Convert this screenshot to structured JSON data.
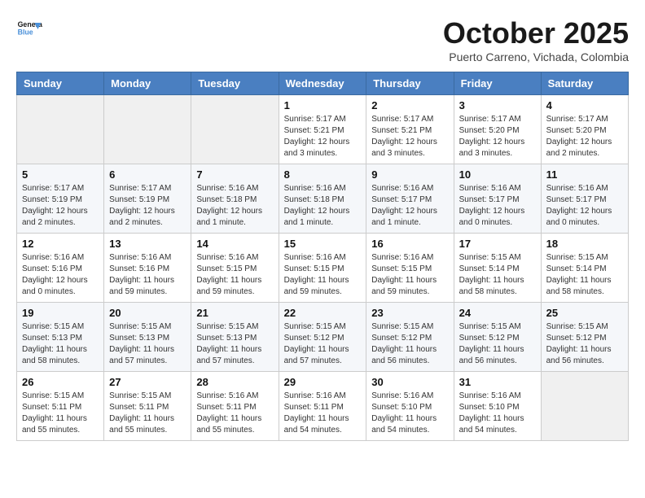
{
  "header": {
    "logo_general": "General",
    "logo_blue": "Blue",
    "month_title": "October 2025",
    "location": "Puerto Carreno, Vichada, Colombia"
  },
  "weekdays": [
    "Sunday",
    "Monday",
    "Tuesday",
    "Wednesday",
    "Thursday",
    "Friday",
    "Saturday"
  ],
  "weeks": [
    [
      {
        "day": "",
        "info": ""
      },
      {
        "day": "",
        "info": ""
      },
      {
        "day": "",
        "info": ""
      },
      {
        "day": "1",
        "info": "Sunrise: 5:17 AM\nSunset: 5:21 PM\nDaylight: 12 hours and 3 minutes."
      },
      {
        "day": "2",
        "info": "Sunrise: 5:17 AM\nSunset: 5:21 PM\nDaylight: 12 hours and 3 minutes."
      },
      {
        "day": "3",
        "info": "Sunrise: 5:17 AM\nSunset: 5:20 PM\nDaylight: 12 hours and 3 minutes."
      },
      {
        "day": "4",
        "info": "Sunrise: 5:17 AM\nSunset: 5:20 PM\nDaylight: 12 hours and 2 minutes."
      }
    ],
    [
      {
        "day": "5",
        "info": "Sunrise: 5:17 AM\nSunset: 5:19 PM\nDaylight: 12 hours and 2 minutes."
      },
      {
        "day": "6",
        "info": "Sunrise: 5:17 AM\nSunset: 5:19 PM\nDaylight: 12 hours and 2 minutes."
      },
      {
        "day": "7",
        "info": "Sunrise: 5:16 AM\nSunset: 5:18 PM\nDaylight: 12 hours and 1 minute."
      },
      {
        "day": "8",
        "info": "Sunrise: 5:16 AM\nSunset: 5:18 PM\nDaylight: 12 hours and 1 minute."
      },
      {
        "day": "9",
        "info": "Sunrise: 5:16 AM\nSunset: 5:17 PM\nDaylight: 12 hours and 1 minute."
      },
      {
        "day": "10",
        "info": "Sunrise: 5:16 AM\nSunset: 5:17 PM\nDaylight: 12 hours and 0 minutes."
      },
      {
        "day": "11",
        "info": "Sunrise: 5:16 AM\nSunset: 5:17 PM\nDaylight: 12 hours and 0 minutes."
      }
    ],
    [
      {
        "day": "12",
        "info": "Sunrise: 5:16 AM\nSunset: 5:16 PM\nDaylight: 12 hours and 0 minutes."
      },
      {
        "day": "13",
        "info": "Sunrise: 5:16 AM\nSunset: 5:16 PM\nDaylight: 11 hours and 59 minutes."
      },
      {
        "day": "14",
        "info": "Sunrise: 5:16 AM\nSunset: 5:15 PM\nDaylight: 11 hours and 59 minutes."
      },
      {
        "day": "15",
        "info": "Sunrise: 5:16 AM\nSunset: 5:15 PM\nDaylight: 11 hours and 59 minutes."
      },
      {
        "day": "16",
        "info": "Sunrise: 5:16 AM\nSunset: 5:15 PM\nDaylight: 11 hours and 59 minutes."
      },
      {
        "day": "17",
        "info": "Sunrise: 5:15 AM\nSunset: 5:14 PM\nDaylight: 11 hours and 58 minutes."
      },
      {
        "day": "18",
        "info": "Sunrise: 5:15 AM\nSunset: 5:14 PM\nDaylight: 11 hours and 58 minutes."
      }
    ],
    [
      {
        "day": "19",
        "info": "Sunrise: 5:15 AM\nSunset: 5:13 PM\nDaylight: 11 hours and 58 minutes."
      },
      {
        "day": "20",
        "info": "Sunrise: 5:15 AM\nSunset: 5:13 PM\nDaylight: 11 hours and 57 minutes."
      },
      {
        "day": "21",
        "info": "Sunrise: 5:15 AM\nSunset: 5:13 PM\nDaylight: 11 hours and 57 minutes."
      },
      {
        "day": "22",
        "info": "Sunrise: 5:15 AM\nSunset: 5:12 PM\nDaylight: 11 hours and 57 minutes."
      },
      {
        "day": "23",
        "info": "Sunrise: 5:15 AM\nSunset: 5:12 PM\nDaylight: 11 hours and 56 minutes."
      },
      {
        "day": "24",
        "info": "Sunrise: 5:15 AM\nSunset: 5:12 PM\nDaylight: 11 hours and 56 minutes."
      },
      {
        "day": "25",
        "info": "Sunrise: 5:15 AM\nSunset: 5:12 PM\nDaylight: 11 hours and 56 minutes."
      }
    ],
    [
      {
        "day": "26",
        "info": "Sunrise: 5:15 AM\nSunset: 5:11 PM\nDaylight: 11 hours and 55 minutes."
      },
      {
        "day": "27",
        "info": "Sunrise: 5:15 AM\nSunset: 5:11 PM\nDaylight: 11 hours and 55 minutes."
      },
      {
        "day": "28",
        "info": "Sunrise: 5:16 AM\nSunset: 5:11 PM\nDaylight: 11 hours and 55 minutes."
      },
      {
        "day": "29",
        "info": "Sunrise: 5:16 AM\nSunset: 5:11 PM\nDaylight: 11 hours and 54 minutes."
      },
      {
        "day": "30",
        "info": "Sunrise: 5:16 AM\nSunset: 5:10 PM\nDaylight: 11 hours and 54 minutes."
      },
      {
        "day": "31",
        "info": "Sunrise: 5:16 AM\nSunset: 5:10 PM\nDaylight: 11 hours and 54 minutes."
      },
      {
        "day": "",
        "info": ""
      }
    ]
  ]
}
